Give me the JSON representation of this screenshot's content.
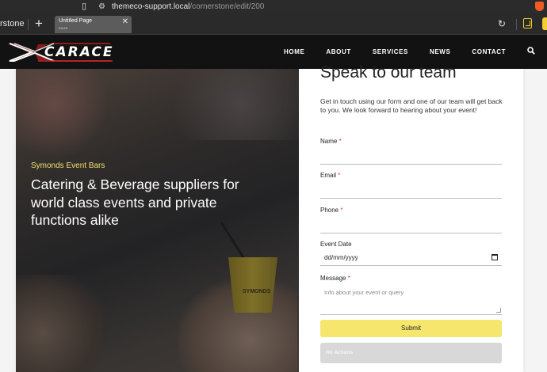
{
  "browser": {
    "url_host": "themeco-support.local",
    "url_path": "/cornerstone/edit/200",
    "prev_tab_label": "rstone",
    "active_tab": {
      "title": "Untitled Page",
      "subtitle": "PAGE",
      "close": "✕"
    },
    "new_tab": "+"
  },
  "nav": {
    "logo": "CARACE",
    "links": [
      "HOME",
      "ABOUT",
      "SERVICES",
      "NEWS",
      "CONTACT"
    ],
    "search_icon": "search-icon"
  },
  "hero": {
    "kicker": "Symonds Event Bars",
    "headline": "Catering & Beverage suppliers for world class events and private functions alike",
    "cup_logo": "SYMONDS"
  },
  "form": {
    "title": "Speak to our team",
    "intro": "Get in touch using our form and one of our team will get back to you. We look forward to hearing about your event!",
    "required_mark": "*",
    "fields": {
      "name": "Name",
      "email": "Email",
      "phone": "Phone",
      "event_date": "Event Date",
      "message": "Message"
    },
    "date_placeholder": "dd/mm/yyyy",
    "message_placeholder": "Info about your event or query",
    "submit": "Submit",
    "no_actions": "No Actions"
  },
  "colors": {
    "accent_yellow": "#f6e66d",
    "kicker_yellow": "#f3e169",
    "required_red": "#d43a3a",
    "nav_bg": "#121212"
  }
}
